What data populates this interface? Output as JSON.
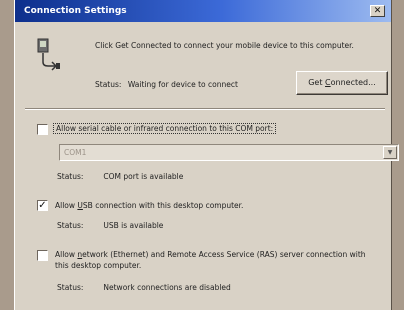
{
  "window": {
    "title": "Connection Settings",
    "close_glyph": "✕"
  },
  "intro": {
    "icon": "handheld-device-icon",
    "text": "Click Get Connected to connect your mobile device to this computer.",
    "status_label": "Status:",
    "status_value": "Waiting for device to connect",
    "get_connected": {
      "pre": "Get ",
      "accel": "C",
      "post": "onnected..."
    }
  },
  "serial": {
    "checked": false,
    "label": "Allow serial cable or infrared connection to this COM port:",
    "port_value": "COM1",
    "status_label": "Status:",
    "status_value": "COM port is available"
  },
  "usb": {
    "checked": true,
    "label_pre": "Allow ",
    "label_accel": "U",
    "label_post": "SB connection with this desktop computer.",
    "status_label": "Status:",
    "status_value": "USB is available"
  },
  "network": {
    "checked": false,
    "label_pre": "Allow ",
    "label_accel": "n",
    "label_post": "etwork (Ethernet) and Remote Access Service (RAS) server connection with this desktop computer.",
    "status_label": "Status:",
    "status_value": "Network connections are disabled"
  }
}
